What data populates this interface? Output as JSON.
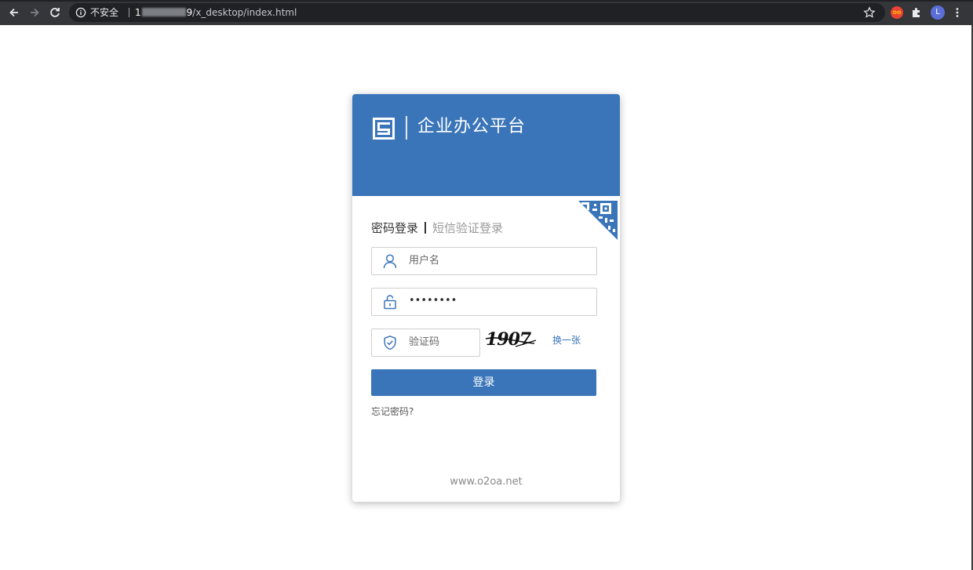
{
  "browser": {
    "security_label": "不安全",
    "url_host_prefix": "1",
    "url_host_suffix": "9",
    "url_path": "/x_desktop/index.html",
    "avatar_initial": "L",
    "extension_label": "oo"
  },
  "login": {
    "title": "企业办公平台",
    "tabs": {
      "password_tab": "密码登录",
      "sms_tab": "短信验证登录"
    },
    "username_placeholder": "用户名",
    "password_mask": "••••••••",
    "captcha_placeholder": "验证码",
    "captcha_value": "1907",
    "refresh_label": "换一张",
    "submit_label": "登录",
    "forgot_label": "忘记密码?",
    "footer_site": "www.o2oa.net"
  },
  "colors": {
    "brand_blue": "#3b75b9",
    "chrome_dark": "#35363a"
  }
}
